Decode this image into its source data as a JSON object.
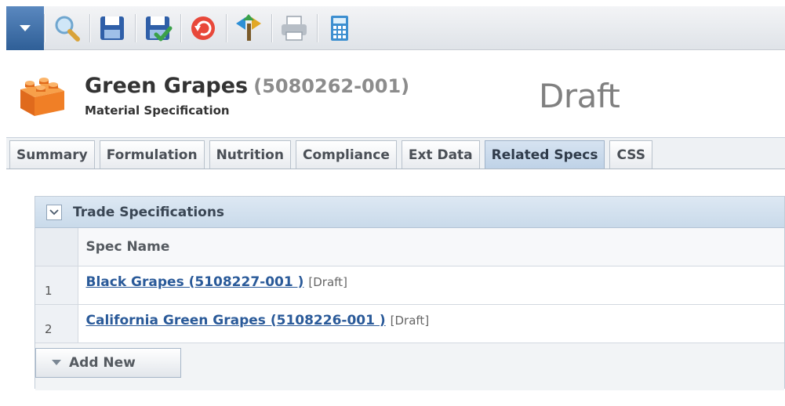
{
  "toolbar": {
    "buttons": [
      {
        "icon": "search-icon"
      },
      {
        "icon": "save-icon"
      },
      {
        "icon": "save-and-close-icon"
      },
      {
        "icon": "undo-icon"
      },
      {
        "icon": "workflow-icon"
      },
      {
        "icon": "print-icon"
      },
      {
        "icon": "calculator-icon"
      }
    ]
  },
  "header": {
    "title": "Green Grapes",
    "code": "(5080262-001)",
    "subtitle": "Material Specification",
    "status": "Draft"
  },
  "tabs": [
    {
      "label": "Summary",
      "active": false
    },
    {
      "label": "Formulation",
      "active": false
    },
    {
      "label": "Nutrition",
      "active": false
    },
    {
      "label": "Compliance",
      "active": false
    },
    {
      "label": "Ext Data",
      "active": false
    },
    {
      "label": "Related Specs",
      "active": true
    },
    {
      "label": "CSS",
      "active": false
    }
  ],
  "panel": {
    "title": "Trade Specifications",
    "column_header": "Spec Name",
    "rows": [
      {
        "index": "1",
        "name": "Black Grapes (5108227-001 )",
        "status": "[Draft]"
      },
      {
        "index": "2",
        "name": "California Green Grapes (5108226-001 )",
        "status": "[Draft]"
      }
    ],
    "add_label": "Add New"
  },
  "colors": {
    "accent": "#2f5f97",
    "link": "#2a5a99",
    "active_tab": "#c9daea"
  }
}
